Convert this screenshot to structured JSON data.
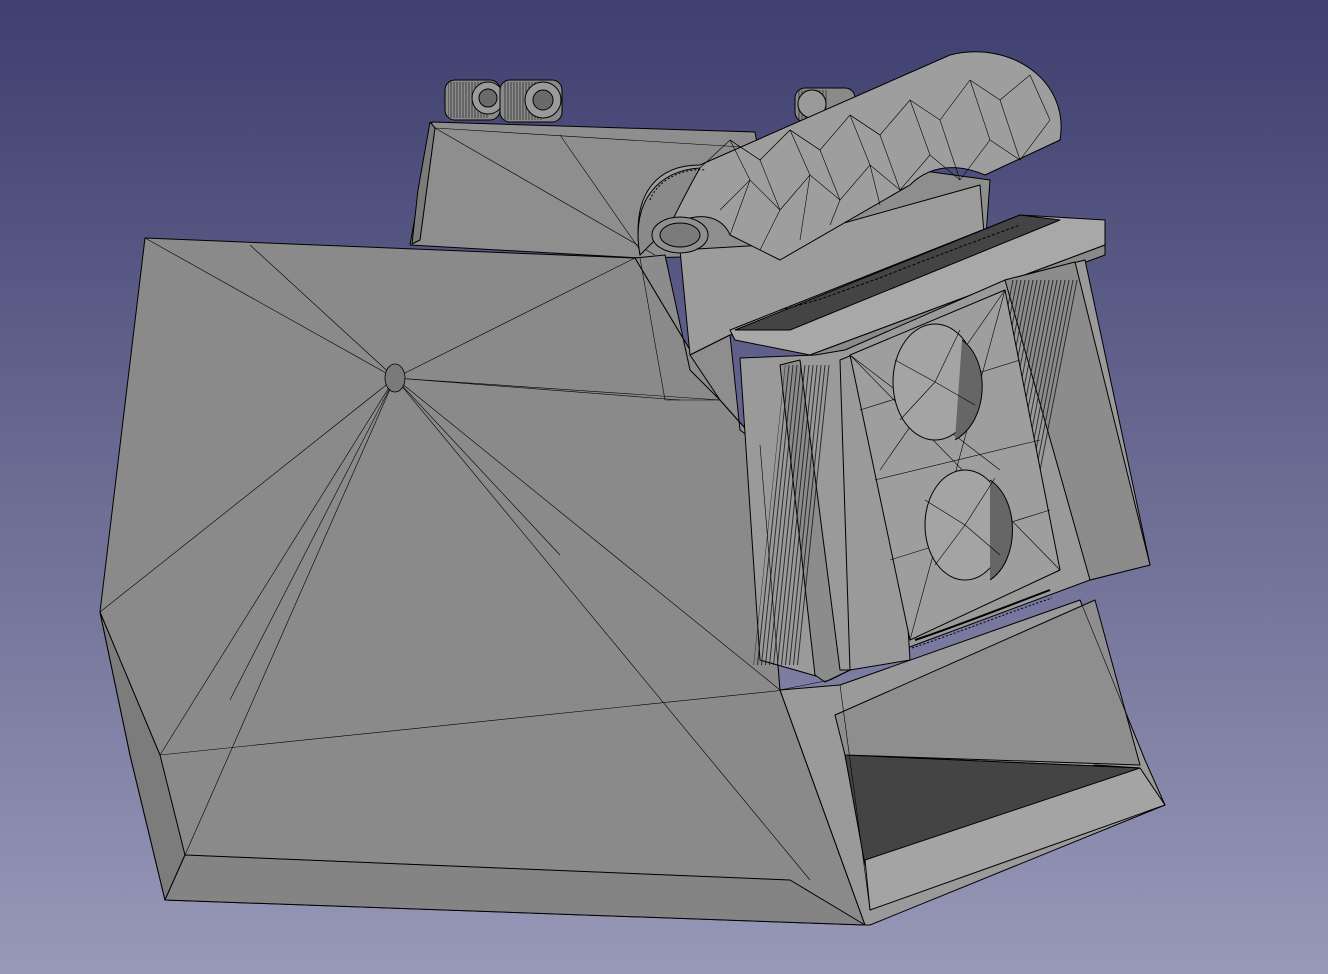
{
  "viewer": {
    "background_top": "#3f3f70",
    "background_bottom": "#9898b8"
  },
  "model": {
    "face_color": "#8c8c8c",
    "face_light": "#9b9b9b",
    "face_dark": "#444444",
    "edge_color": "#000000"
  }
}
